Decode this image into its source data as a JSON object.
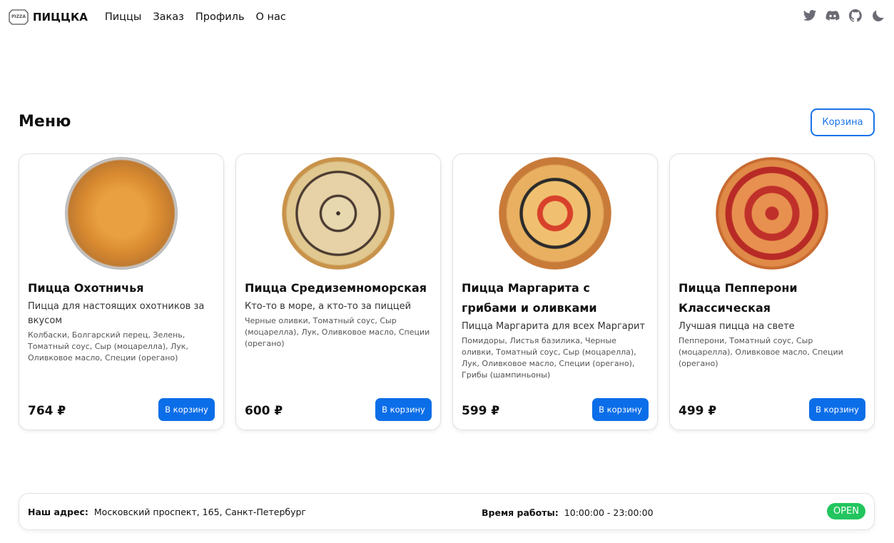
{
  "nav": {
    "brand": "ПИЦЦКА",
    "logo_text": "PIZZA",
    "links": [
      "Пиццы",
      "Заказ",
      "Профиль",
      "О нас"
    ],
    "icons": [
      "twitter-icon",
      "discord-icon",
      "github-icon",
      "moon-icon"
    ]
  },
  "menu": {
    "title": "Меню",
    "cart_label": "Корзина"
  },
  "cards": [
    {
      "title": "Пицца Охотничья",
      "subtitle": "Пицца для настоящих охотников за вкусом",
      "ingredients": "Колбаски, Болгарский перец, Зелень, Томатный соус, Сыр (моцарелла), Лук, Оливковое масло, Специи (орегано)",
      "price": "764 ₽",
      "button": "В корзину"
    },
    {
      "title": "Пицца Средиземноморская",
      "subtitle": "Кто-то в море, а кто-то за пиццей",
      "ingredients": "Черные оливки, Томатный соус, Сыр (моцарелла), Лук, Оливковое масло, Специи (орегано)",
      "price": "600 ₽",
      "button": "В корзину"
    },
    {
      "title": "Пицца Маргарита с грибами и оливками",
      "subtitle": "Пицца Маргарита для всех Маргарит",
      "ingredients": "Помидоры, Листья базилика, Черные оливки, Томатный соус, Сыр (моцарелла), Лук, Оливковое масло, Специи (орегано), Грибы (шампиньоны)",
      "price": "599 ₽",
      "button": "В корзину"
    },
    {
      "title": "Пицца Пепперони Классическая",
      "subtitle": "Лучшая пицца на свете",
      "ingredients": "Пепперони, Томатный соус, Сыр (моцарелла), Оливковое масло, Специи (орегано)",
      "price": "499 ₽",
      "button": "В корзину"
    }
  ],
  "footer": {
    "address_label": "Наш адрес:",
    "address": "Московский проспект, 165, Санкт-Петербург",
    "hours_label": "Время работы:",
    "hours": "10:00:00 - 23:00:00",
    "status": "OPEN"
  },
  "colors": {
    "accent": "#0b6ee8",
    "open": "#22c55e"
  }
}
